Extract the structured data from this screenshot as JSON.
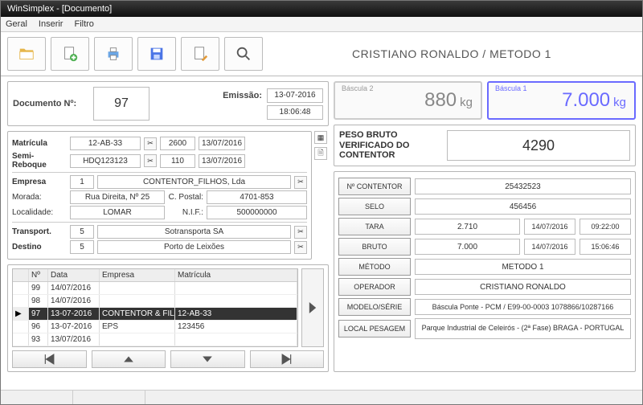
{
  "window": {
    "title": "WinSimplex - [Documento]"
  },
  "menu": {
    "geral": "Geral",
    "inserir": "Inserir",
    "filtro": "Filtro"
  },
  "headline": "CRISTIANO RONALDO / METODO 1",
  "doc": {
    "label": "Documento Nº:",
    "number": "97",
    "emissao_label": "Emissão:",
    "date": "13-07-2016",
    "time": "18:06:48"
  },
  "vehicle": {
    "matricula_label": "Matrícula",
    "matricula": "12-AB-33",
    "matricula_peso": "2600",
    "matricula_data": "13/07/2016",
    "semi_label": "Semi-Reboque",
    "semi": "HDQ123123",
    "semi_peso": "110",
    "semi_data": "13/07/2016",
    "empresa_label": "Empresa",
    "empresa_id": "1",
    "empresa_nome": "CONTENTOR_FILHOS, Lda",
    "morada_label": "Morada:",
    "morada": "Rua Direita, Nº 25",
    "cpostal_label": "C. Postal:",
    "cpostal": "4701-853",
    "localidade_label": "Localidade:",
    "localidade": "LOMAR",
    "nif_label": "N.I.F.:",
    "nif": "500000000",
    "transport_label": "Transport.",
    "transport_id": "5",
    "transport_nome": "Sotransporta SA",
    "destino_label": "Destino",
    "destino_id": "5",
    "destino_nome": "Porto de Leixões"
  },
  "grid": {
    "h_num": "Nº",
    "h_data": "Data",
    "h_emp": "Empresa",
    "h_mat": "Matrícula",
    "rows": [
      {
        "num": "99",
        "data": "14/07/2016",
        "emp": "",
        "mat": ""
      },
      {
        "num": "98",
        "data": "14/07/2016",
        "emp": "",
        "mat": ""
      },
      {
        "num": "97",
        "data": "13-07-2016",
        "emp": "CONTENTOR & FILHO",
        "mat": "12-AB-33",
        "selected": true
      },
      {
        "num": "96",
        "data": "13-07-2016",
        "emp": "EPS",
        "mat": "123456"
      },
      {
        "num": "93",
        "data": "13/07/2016",
        "emp": "",
        "mat": ""
      }
    ]
  },
  "scales": {
    "b2_label": "Báscula 2",
    "b2_val": "880",
    "b2_unit": "kg",
    "b1_label": "Báscula 1",
    "b1_val": "7.000",
    "b1_unit": "kg"
  },
  "pbv": {
    "label": "PESO BRUTO VERIFICADO DO CONTENTOR",
    "value": "4290"
  },
  "details": {
    "contentor_btn": "Nº CONTENTOR",
    "contentor": "25432523",
    "selo_btn": "SELO",
    "selo": "456456",
    "tara_btn": "TARA",
    "tara": "2.710",
    "tara_data": "14/07/2016",
    "tara_hora": "09:22:00",
    "bruto_btn": "BRUTO",
    "bruto": "7.000",
    "bruto_data": "14/07/2016",
    "bruto_hora": "15:06:46",
    "metodo_btn": "MÉTODO",
    "metodo": "METODO 1",
    "operador_btn": "OPERADOR",
    "operador": "CRISTIANO RONALDO",
    "modelo_btn": "MODELO/SÉRIE",
    "modelo": "Báscula Ponte - PCM / E99-00-0003    1078866/10287166",
    "local_btn": "LOCAL PESAGEM",
    "local": "Parque Industrial de Celeirós - (2ª Fase) BRAGA - PORTUGAL"
  }
}
